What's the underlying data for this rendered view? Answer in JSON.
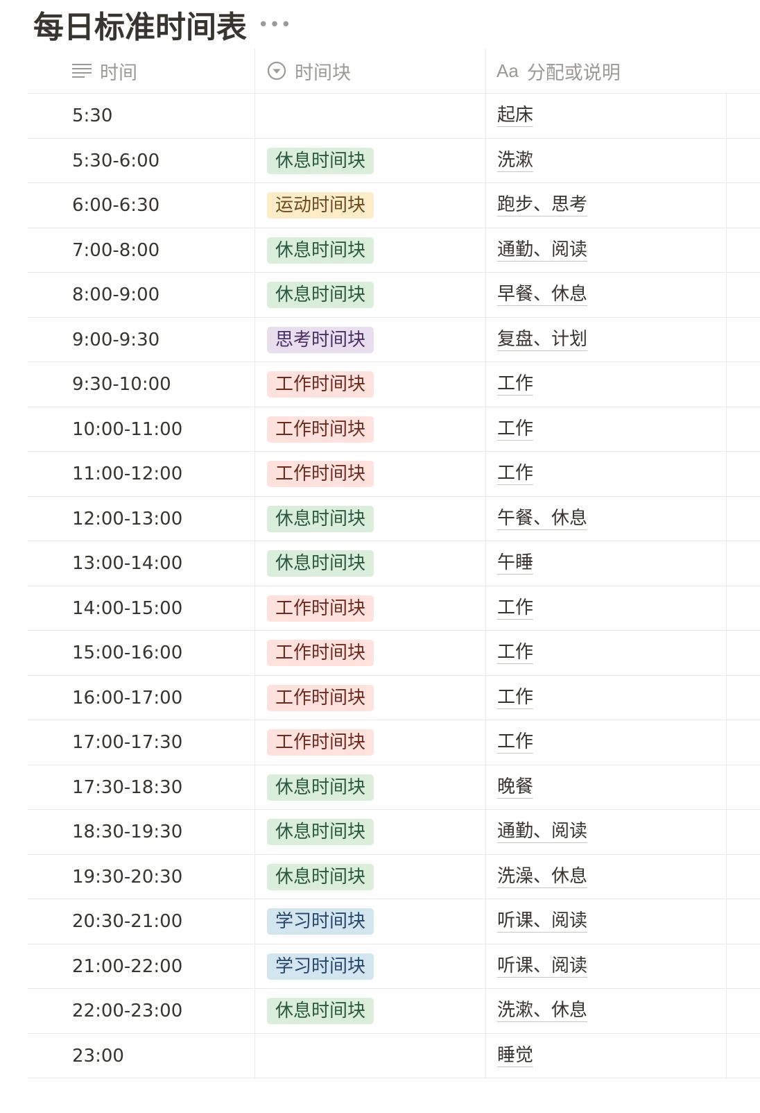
{
  "title": "每日标准时间表",
  "more_icon": "•••",
  "headers": {
    "time": "时间",
    "block": "时间块",
    "note_prefix": "Aa",
    "note": "分配或说明"
  },
  "tag_colors": {
    "rest": {
      "bg": "#dbeddb",
      "fg": "#2b593f"
    },
    "sport": {
      "bg": "#fdecc8",
      "fg": "#6e4a20"
    },
    "think": {
      "bg": "#e8deee",
      "fg": "#492f64"
    },
    "work": {
      "bg": "#ffe2dd",
      "fg": "#6e2a1e"
    },
    "study": {
      "bg": "#d3e5ef",
      "fg": "#28456c"
    }
  },
  "rows": [
    {
      "time": "5:30",
      "block": "",
      "kind": "",
      "note": "起床"
    },
    {
      "time": "5:30-6:00",
      "block": "休息时间块",
      "kind": "rest",
      "note": "洗漱"
    },
    {
      "time": "6:00-6:30",
      "block": "运动时间块",
      "kind": "sport",
      "note": "跑步、思考"
    },
    {
      "time": "7:00-8:00",
      "block": "休息时间块",
      "kind": "rest",
      "note": "通勤、阅读"
    },
    {
      "time": "8:00-9:00",
      "block": "休息时间块",
      "kind": "rest",
      "note": "早餐、休息"
    },
    {
      "time": "9:00-9:30",
      "block": "思考时间块",
      "kind": "think",
      "note": "复盘、计划"
    },
    {
      "time": "9:30-10:00",
      "block": "工作时间块",
      "kind": "work",
      "note": "工作"
    },
    {
      "time": "10:00-11:00",
      "block": "工作时间块",
      "kind": "work",
      "note": "工作"
    },
    {
      "time": "11:00-12:00",
      "block": "工作时间块",
      "kind": "work",
      "note": "工作"
    },
    {
      "time": "12:00-13:00",
      "block": "休息时间块",
      "kind": "rest",
      "note": "午餐、休息"
    },
    {
      "time": "13:00-14:00",
      "block": "休息时间块",
      "kind": "rest",
      "note": "午睡"
    },
    {
      "time": "14:00-15:00",
      "block": "工作时间块",
      "kind": "work",
      "note": "工作"
    },
    {
      "time": "15:00-16:00",
      "block": "工作时间块",
      "kind": "work",
      "note": "工作"
    },
    {
      "time": "16:00-17:00",
      "block": "工作时间块",
      "kind": "work",
      "note": "工作"
    },
    {
      "time": "17:00-17:30",
      "block": "工作时间块",
      "kind": "work",
      "note": "工作"
    },
    {
      "time": "17:30-18:30",
      "block": "休息时间块",
      "kind": "rest",
      "note": "晚餐"
    },
    {
      "time": "18:30-19:30",
      "block": "休息时间块",
      "kind": "rest",
      "note": "通勤、阅读"
    },
    {
      "time": "19:30-20:30",
      "block": "休息时间块",
      "kind": "rest",
      "note": "洗澡、休息"
    },
    {
      "time": "20:30-21:00",
      "block": "学习时间块",
      "kind": "study",
      "note": "听课、阅读"
    },
    {
      "time": "21:00-22:00",
      "block": "学习时间块",
      "kind": "study",
      "note": "听课、阅读"
    },
    {
      "time": "22:00-23:00",
      "block": "休息时间块",
      "kind": "rest",
      "note": "洗漱、休息"
    },
    {
      "time": "23:00",
      "block": "",
      "kind": "",
      "note": "睡觉"
    }
  ]
}
